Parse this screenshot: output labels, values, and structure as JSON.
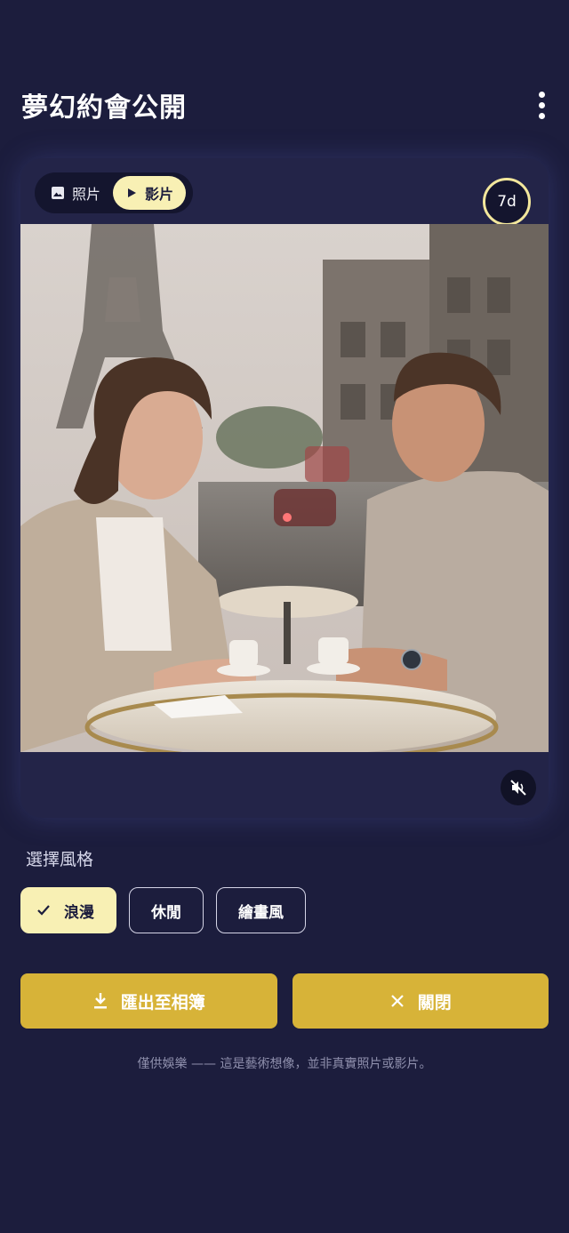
{
  "header": {
    "title": "夢幻約會公開",
    "menu_icon": "more-vertical-icon"
  },
  "media_card": {
    "tabs": [
      {
        "label": "照片",
        "icon": "image-icon",
        "active": false
      },
      {
        "label": "影片",
        "icon": "play-icon",
        "active": true
      }
    ],
    "expiry_badge": "7d",
    "image_alt": "A smiling couple at a Paris café table with the Eiffel Tower behind them",
    "mute_icon": "volume-off-icon"
  },
  "style_section": {
    "label": "選擇風格",
    "options": [
      {
        "label": "浪漫",
        "selected": true
      },
      {
        "label": "休閒",
        "selected": false
      },
      {
        "label": "繪畫風",
        "selected": false
      }
    ]
  },
  "actions": {
    "export_label": "匯出至相簿",
    "export_icon": "download-icon",
    "close_label": "關閉",
    "close_icon": "close-icon"
  },
  "disclaimer": "僅供娛樂 —— 這是藝術想像，並非真實照片或影片。",
  "colors": {
    "background": "#1c1d3d",
    "accent_yellow": "#d7b338",
    "pale_yellow": "#f8f0b4"
  }
}
